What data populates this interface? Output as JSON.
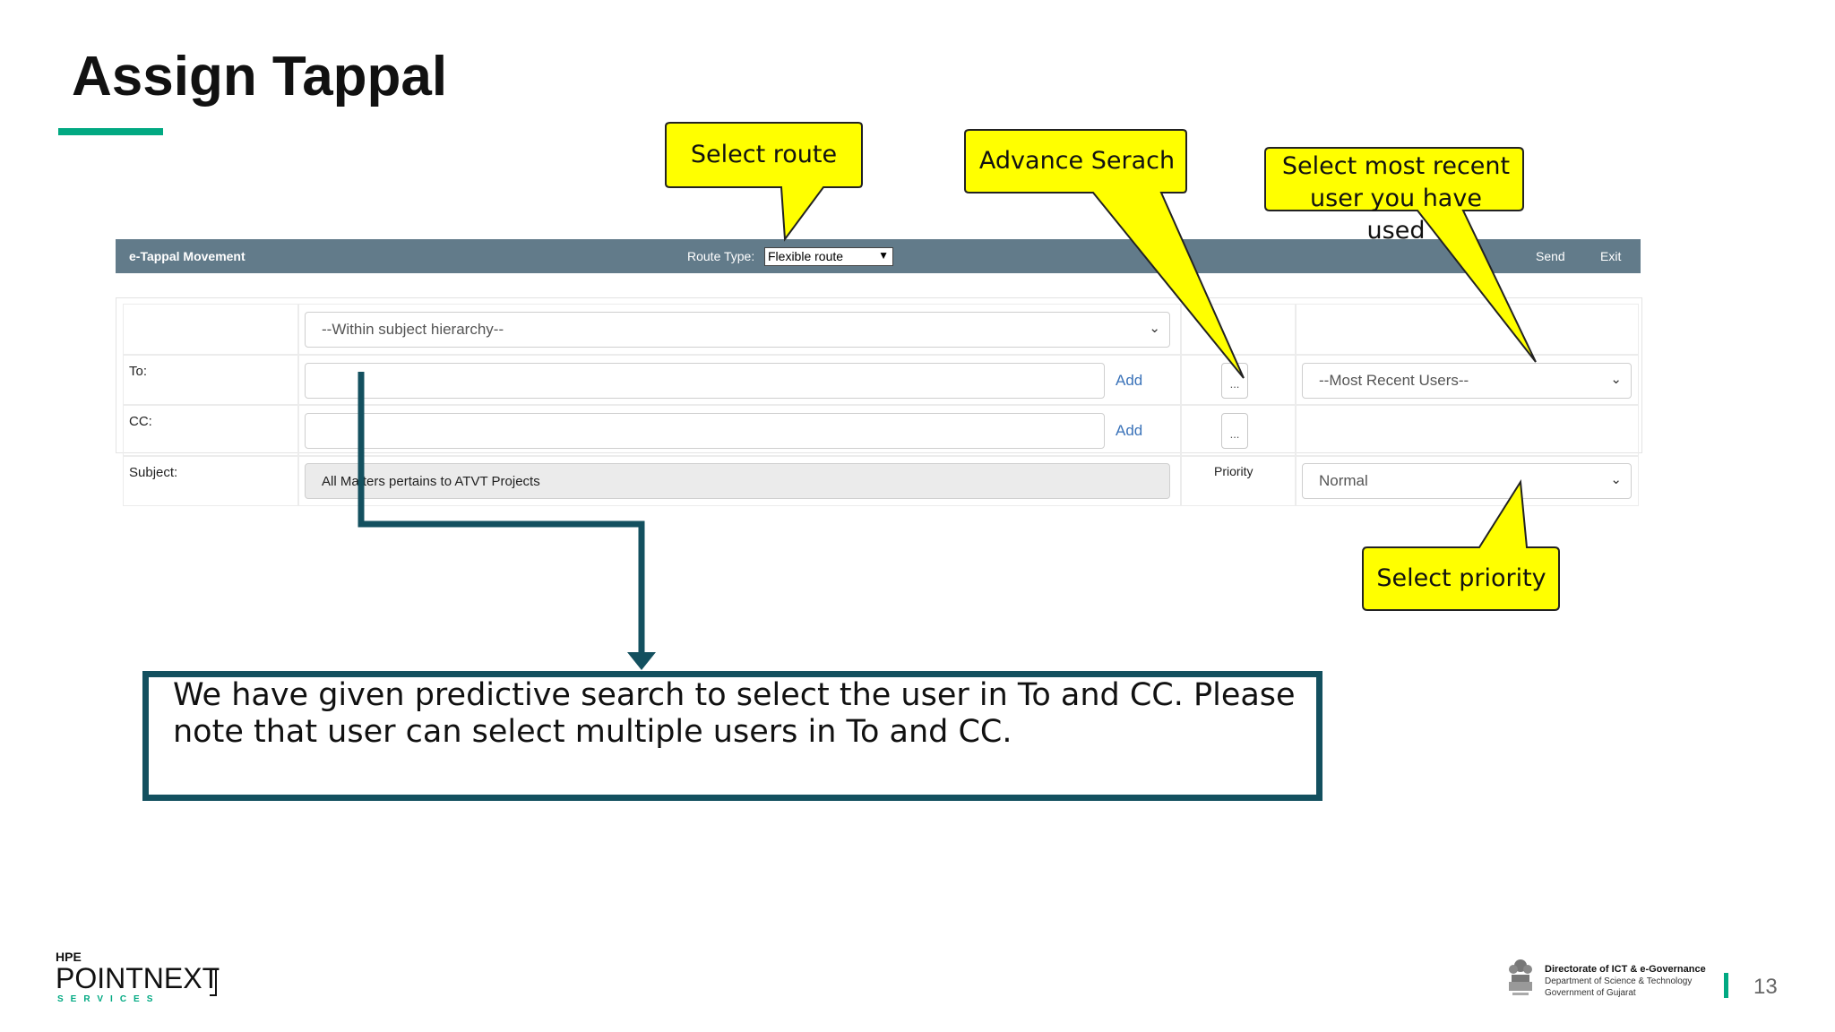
{
  "slide": {
    "title": "Assign Tappal",
    "page_number": "13"
  },
  "app_bar": {
    "title": "e-Tappal Movement",
    "route_type_label": "Route Type:",
    "route_type_value": "Flexible route",
    "send_label": "Send",
    "exit_label": "Exit"
  },
  "form": {
    "hierarchy_select": "--Within subject hierarchy--",
    "to_label": "To:",
    "cc_label": "CC:",
    "subject_label": "Subject:",
    "subject_value": "All Matters pertains to ATVT Projects",
    "add_label": "Add",
    "advance_search_label": "...",
    "recent_users_select": "--Most Recent Users--",
    "priority_label": "Priority",
    "priority_value": "Normal"
  },
  "callouts": {
    "select_route": "Select route",
    "advance_search": "Advance Serach",
    "recent_user": "Select most recent user you have used",
    "select_priority": "Select priority"
  },
  "note": {
    "text": "We have given predictive search to select the user in To and CC. Please note that user can select multiple users in To and CC."
  },
  "footer": {
    "brand_top": "HPE",
    "brand_name": "POINTNEXT",
    "brand_sub": "SERVICES",
    "org_line1": "Directorate of ICT & e-Governance",
    "org_line2": "Department of Science & Technology",
    "org_line3": "Government of Gujarat"
  },
  "colors": {
    "accent": "#01a982",
    "bar": "#627b8a",
    "callout_fill": "#ffff00",
    "note_border": "#13505f",
    "link": "#3b73b9"
  }
}
